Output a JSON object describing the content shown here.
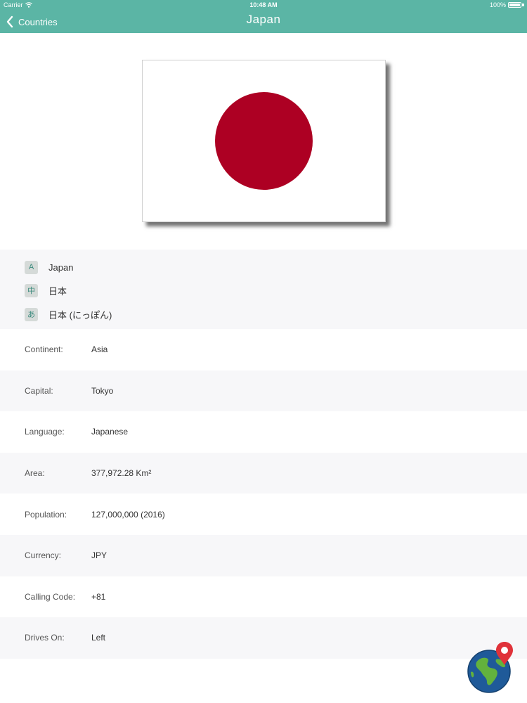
{
  "status_bar": {
    "carrier": "Carrier",
    "time": "10:48 AM",
    "battery": "100%"
  },
  "nav": {
    "back_label": "Countries",
    "title": "Japan"
  },
  "flag": {
    "field_color": "#ffffff",
    "disc_color": "#ad0023"
  },
  "names": [
    {
      "badge": "A",
      "text": "Japan"
    },
    {
      "badge": "中",
      "text": "日本"
    },
    {
      "badge": "あ",
      "text": "日本 (にっぽん)"
    }
  ],
  "info": [
    {
      "label": "Continent:",
      "value": "Asia"
    },
    {
      "label": "Capital:",
      "value": "Tokyo"
    },
    {
      "label": "Language:",
      "value": "Japanese"
    },
    {
      "label": "Area:",
      "value": "377,972.28 Km²"
    },
    {
      "label": "Population:",
      "value": "127,000,000 (2016)"
    },
    {
      "label": "Currency:",
      "value": "JPY"
    },
    {
      "label": "Calling Code:",
      "value": "+81"
    },
    {
      "label": "Drives On:",
      "value": "Left"
    }
  ],
  "colors": {
    "header": "#5bb5a5",
    "badge_bg": "#d5dad8",
    "badge_fg": "#3a8a7d",
    "row_alt": "#f7f7f9",
    "map_pin": "#e0323a",
    "globe_ocean": "#1f5a99",
    "globe_land": "#63b23d"
  },
  "icons": {
    "back": "chevron-left-icon",
    "wifi": "wifi-icon",
    "battery": "battery-icon",
    "globe": "globe-map-pin-icon"
  }
}
